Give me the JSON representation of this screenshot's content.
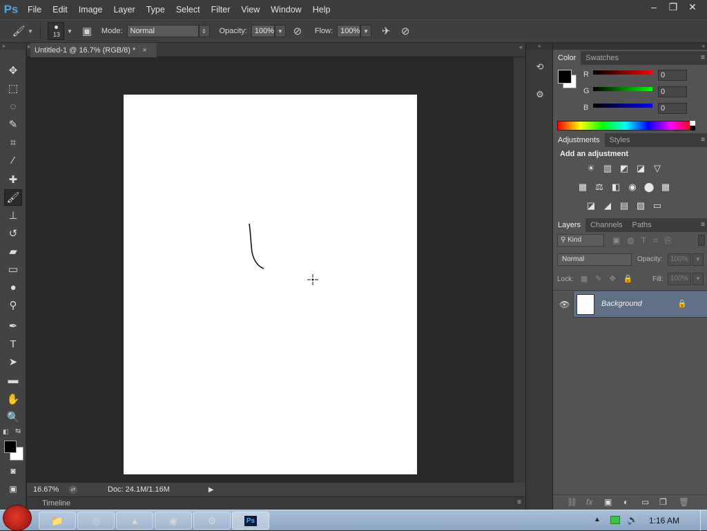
{
  "app": {
    "logo": "Ps"
  },
  "menu": [
    "File",
    "Edit",
    "Image",
    "Layer",
    "Type",
    "Select",
    "Filter",
    "View",
    "Window",
    "Help"
  ],
  "window_controls": {
    "minimize": "–",
    "restore": "❐",
    "close": "✕"
  },
  "options": {
    "brush_size": "13",
    "mode_label": "Mode:",
    "mode_value": "Normal",
    "opacity_label": "Opacity:",
    "opacity_value": "100%",
    "flow_label": "Flow:",
    "flow_value": "100%"
  },
  "document": {
    "tab_title": "Untitled-1 @ 16.7% (RGB/8) *",
    "tab_close": "×",
    "zoom": "16.67%",
    "doc_info": "Doc: 24.1M/1.16M",
    "timeline_label": "Timeline"
  },
  "color_panel": {
    "tabs": [
      "Color",
      "Swatches"
    ],
    "channels": [
      {
        "label": "R",
        "value": "0",
        "color": "#d82020"
      },
      {
        "label": "G",
        "value": "0",
        "color": "#20c020"
      },
      {
        "label": "B",
        "value": "0",
        "color": "#2040e0"
      }
    ],
    "foreground": "#000000",
    "background": "#ffffff"
  },
  "adjustments_panel": {
    "tabs": [
      "Adjustments",
      "Styles"
    ],
    "heading": "Add an adjustment",
    "icon_rows": [
      [
        "brightness-contrast-icon",
        "levels-icon",
        "curves-icon",
        "exposure-icon",
        "vibrance-icon"
      ],
      [
        "hue-saturation-icon",
        "color-balance-icon",
        "black-white-icon",
        "photo-filter-icon",
        "channel-mixer-icon",
        "color-lookup-icon"
      ],
      [
        "invert-icon",
        "posterize-icon",
        "threshold-icon",
        "selective-color-icon",
        "gradient-map-icon"
      ]
    ],
    "icon_glyphs": [
      [
        "☀",
        "▥",
        "◩",
        "◪",
        "▽"
      ],
      [
        "▦",
        "⚖",
        "◧",
        "◉",
        "⬤",
        "▦"
      ],
      [
        "◪",
        "◢",
        "▤",
        "▧",
        "▭"
      ]
    ]
  },
  "layers_panel": {
    "tabs": [
      "Layers",
      "Channels",
      "Paths"
    ],
    "kind_label": "Kind",
    "blend_mode": "Normal",
    "opacity_label": "Opacity:",
    "opacity_value": "100%",
    "lock_label": "Lock:",
    "fill_label": "Fill:",
    "fill_value": "100%",
    "layers": [
      {
        "name": "Background",
        "visible": true,
        "locked": true
      }
    ]
  },
  "taskbar": {
    "time": "1:16 AM"
  }
}
